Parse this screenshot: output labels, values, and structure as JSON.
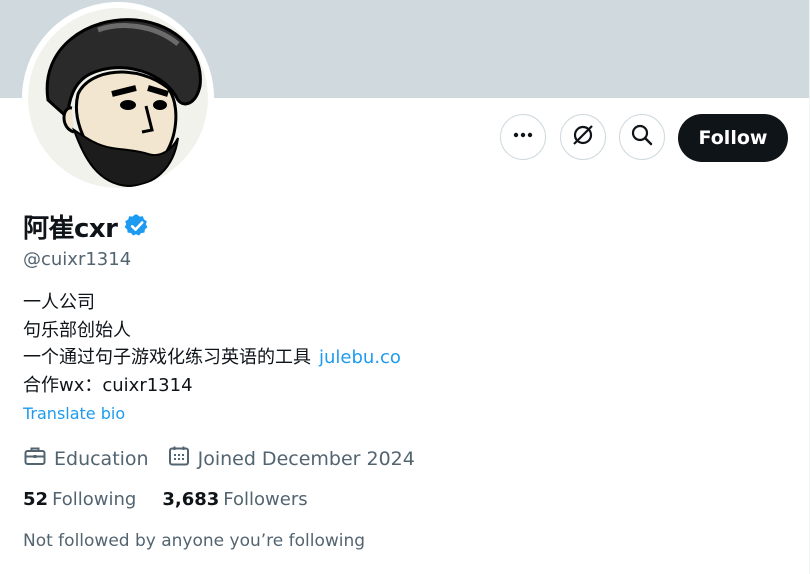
{
  "profile": {
    "display_name": "阿崔cxr",
    "handle": "@cuixr1314",
    "verified": true,
    "bio": {
      "line1": "一人公司",
      "line2": "句乐部创始人",
      "line3": "一个通过句子游戏化练习英语的工具",
      "link": "julebu.co",
      "line4": "合作wx：cuixr1314"
    },
    "translate_label": "Translate bio",
    "category": "Education",
    "joined": "Joined December 2024",
    "following_count": "52",
    "following_label": "Following",
    "followers_count": "3,683",
    "followers_label": "Followers",
    "followed_by_note": "Not followed by anyone you’re following"
  },
  "actions": {
    "more_icon": "more-icon",
    "grok_icon": "grok-icon",
    "search_icon": "search-icon",
    "follow_label": "Follow"
  },
  "colors": {
    "accent": "#1d9bf0",
    "banner": "#cfd9de",
    "text": "#0f1419",
    "muted": "#536471",
    "button": "#0f1419"
  }
}
